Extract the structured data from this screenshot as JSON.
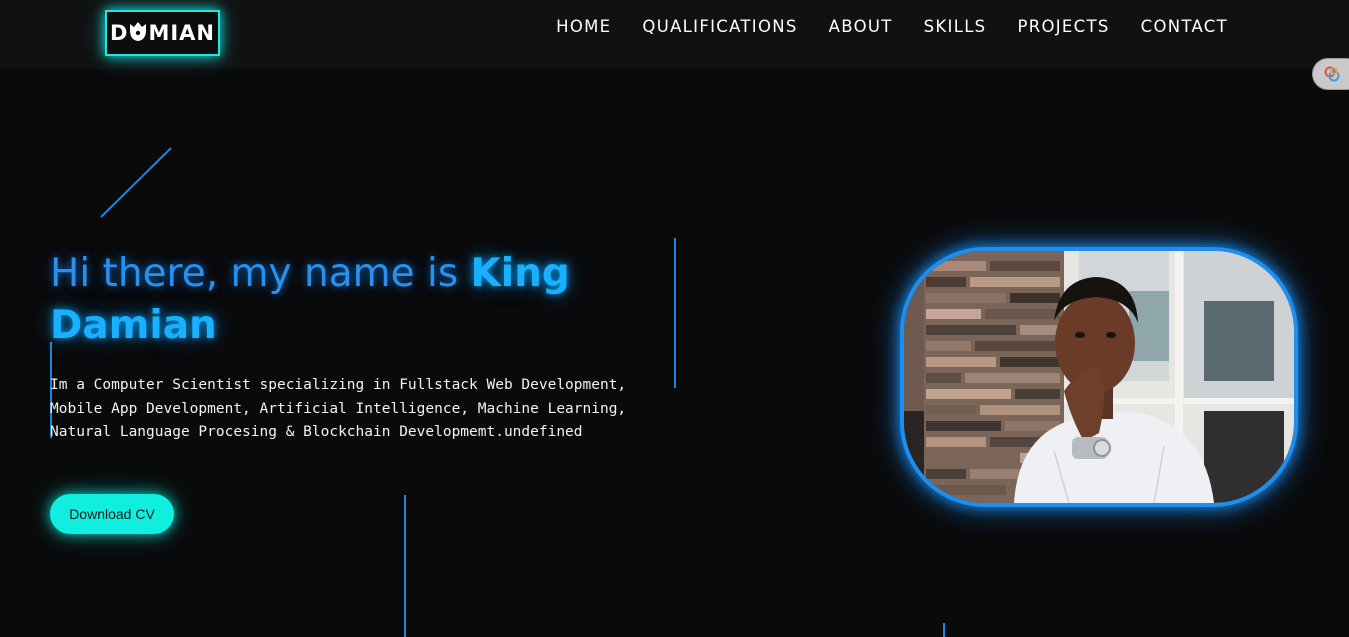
{
  "logo": {
    "text_left": "D",
    "text_right": "MIAN"
  },
  "nav": {
    "items": [
      {
        "label": "HOME"
      },
      {
        "label": "QUALIFICATIONS"
      },
      {
        "label": "ABOUT"
      },
      {
        "label": "SKILLS"
      },
      {
        "label": "PROJECTS"
      },
      {
        "label": "CONTACT"
      }
    ]
  },
  "hero": {
    "greeting": "Hi there, my name is ",
    "name": "King Damian",
    "description": "Im a Computer Scientist specializing in Fullstack Web Development, Mobile App Development, Artificial Intelligence, Machine Learning, Natural Language Procesing & Blockchain Developmemt.undefined",
    "cv_button": "Download CV"
  },
  "colors": {
    "background": "#0a0a0b",
    "navbar": "#111112",
    "accent_cyan": "#10eee0",
    "accent_blue": "#1c8ff0",
    "heading_blue": "#2891f0",
    "text": "#f2f2f2"
  },
  "icons": {
    "side_widget": "extension-icon",
    "logo_crown": "crown-icon"
  }
}
